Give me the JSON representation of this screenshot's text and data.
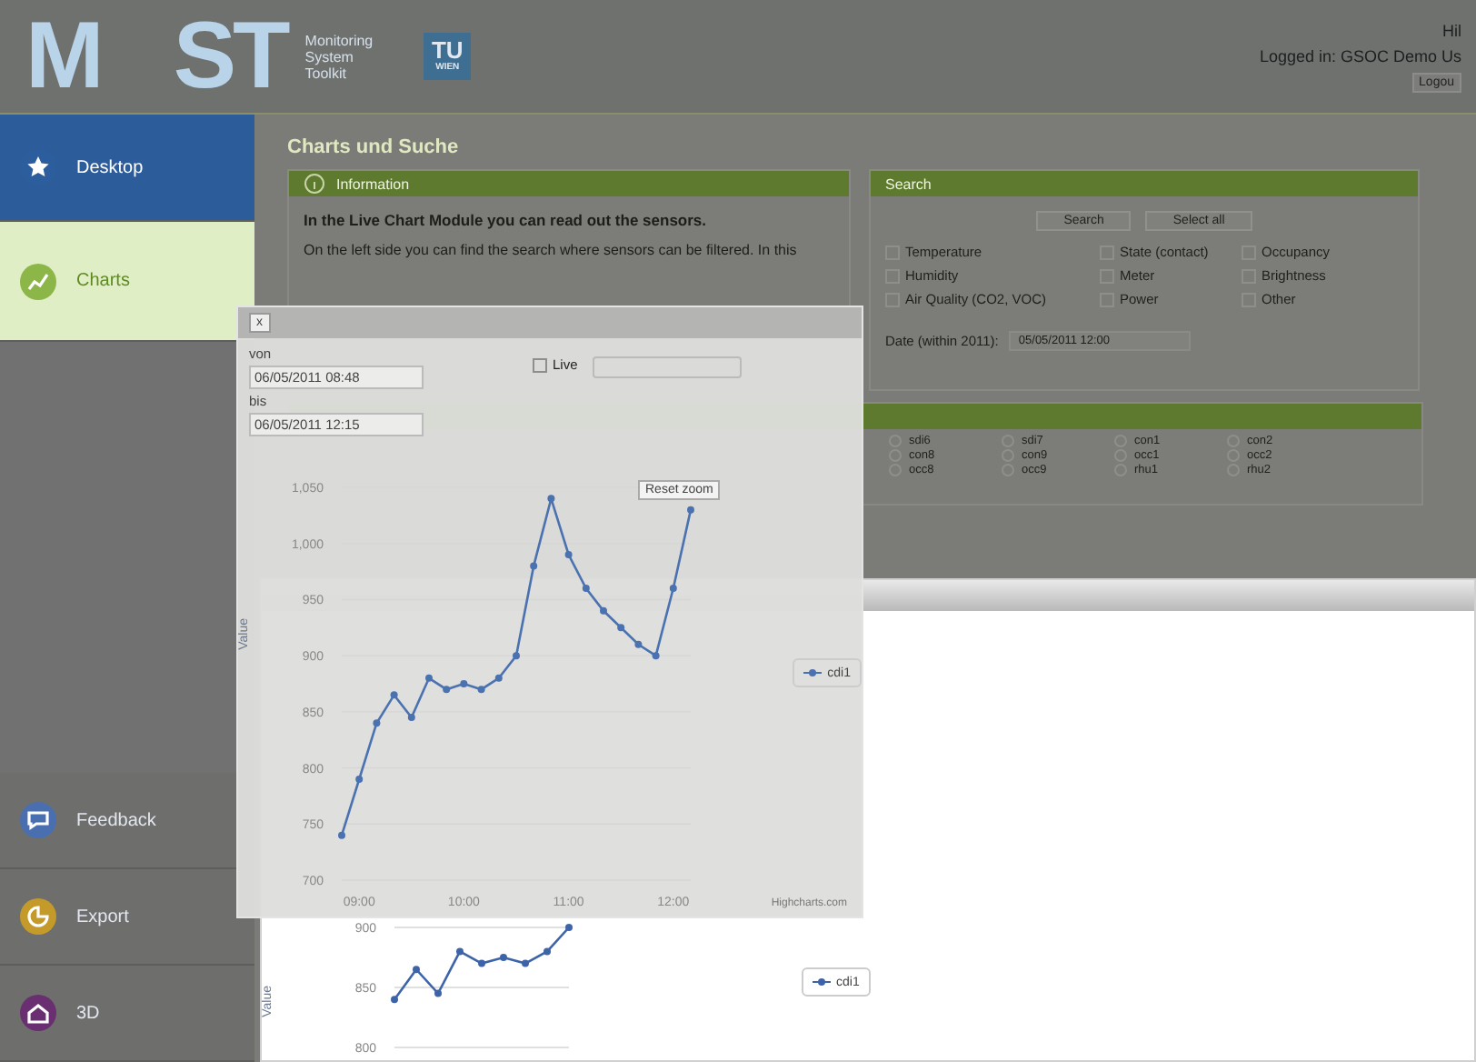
{
  "header": {
    "logo_letters": [
      "M",
      "ST"
    ],
    "logo_subtitle": [
      "Monitoring",
      "System",
      "Toolkit"
    ],
    "university_mark": "TU",
    "university_submark": "WIEN",
    "help": "Hil",
    "logged_in": "Logged in: GSOC Demo Us",
    "logout": "Logou"
  },
  "sidebar": {
    "items": [
      {
        "label": "Desktop",
        "kind": "star",
        "selected": false,
        "hovered": true,
        "color": "#2c5e9e"
      },
      {
        "label": "Charts",
        "kind": "chart",
        "selected": true,
        "hovered": false,
        "color": "#8cb648"
      },
      {
        "label": "Feedback",
        "kind": "bubble",
        "selected": false,
        "hovered": false,
        "color": "#4a6fb0"
      },
      {
        "label": "Export",
        "kind": "pie",
        "selected": false,
        "hovered": false,
        "color": "#c49a2a"
      },
      {
        "label": "3D",
        "kind": "house",
        "selected": false,
        "hovered": false,
        "color": "#6a2f70"
      }
    ]
  },
  "page_title": "Charts und Suche",
  "info": {
    "title": "Information",
    "lead": "In the Live Chart Module you can read out the sensors.",
    "text": "On the left side you can find the search where sensors can be filtered. In this"
  },
  "search": {
    "title": "Search",
    "buttons": [
      "Search",
      "Select all"
    ],
    "filters": [
      {
        "label": "Temperature",
        "checked": false
      },
      {
        "label": "State (contact)",
        "checked": false
      },
      {
        "label": "Occupancy",
        "checked": false
      },
      {
        "label": "Humidity",
        "checked": false
      },
      {
        "label": "Meter",
        "checked": false
      },
      {
        "label": "Brightness",
        "checked": false
      },
      {
        "label": "Air Quality (CO2, VOC)",
        "checked": false
      },
      {
        "label": "Power",
        "checked": false
      },
      {
        "label": "Other",
        "checked": false
      }
    ],
    "date_label": "Date (within 2011):",
    "date_value": "05/05/2011 12:00"
  },
  "sensors": {
    "items": [
      {
        "label": "sdi6",
        "selected": false
      },
      {
        "label": "sdi7",
        "selected": false
      },
      {
        "label": "con1",
        "selected": false
      },
      {
        "label": "con2",
        "selected": false
      },
      {
        "label": "con8",
        "selected": false
      },
      {
        "label": "con9",
        "selected": false
      },
      {
        "label": "occ1",
        "selected": false
      },
      {
        "label": "occ2",
        "selected": false
      },
      {
        "label": "occ8",
        "selected": false
      },
      {
        "label": "occ9",
        "selected": false
      },
      {
        "label": "rhu1",
        "selected": false
      },
      {
        "label": "rhu2",
        "selected": false
      }
    ]
  },
  "windows": [
    {
      "kind": "ghost",
      "close": "x",
      "from_label": "von",
      "from": "06/05/2011 08:48",
      "to_label": "bis",
      "to": "06/05/2011 12:15",
      "live": {
        "label": "Live",
        "checked": false
      },
      "reset": "Reset zoom",
      "credit": "Highcharts.com",
      "chart_data": {
        "type": "line",
        "ylabel": "Value",
        "grid": true,
        "categories": [
          null,
          "09:00",
          null,
          null,
          null,
          null,
          null,
          "10:00",
          null,
          null,
          null,
          null,
          null,
          "11:00",
          null,
          null,
          null,
          null,
          null,
          "12:00",
          null
        ],
        "ylim": [
          700,
          1050
        ],
        "yticks": [
          {
            "value": 700,
            "label": "700"
          },
          {
            "value": 750,
            "label": "750"
          },
          {
            "value": 800,
            "label": "800"
          },
          {
            "value": 850,
            "label": "850"
          },
          {
            "value": 900,
            "label": "900"
          },
          {
            "value": 950,
            "label": "950"
          },
          {
            "value": 1000,
            "label": "1,000"
          },
          {
            "value": 1050,
            "label": "1,050"
          }
        ],
        "series": [
          {
            "name": "cdi1",
            "color": "#4a72b0",
            "marker": "circle",
            "values": [
              740,
              790,
              840,
              865,
              845,
              880,
              870,
              875,
              870,
              880,
              900,
              980,
              1040,
              990,
              960,
              940,
              925,
              910,
              900,
              960,
              1030
            ]
          }
        ]
      }
    },
    {
      "kind": "front",
      "chart_data": {
        "type": "line",
        "ylabel": "Value",
        "grid": true,
        "ylim": [
          800,
          900
        ],
        "yticks": [
          {
            "value": 800,
            "label": "800"
          },
          {
            "value": 850,
            "label": "850"
          },
          {
            "value": 900,
            "label": "900"
          }
        ],
        "series": [
          {
            "name": "cdi1",
            "color": "#3d64a8",
            "marker": "circle",
            "values": [
              840,
              865,
              845,
              880,
              870,
              875,
              870,
              880,
              900
            ]
          }
        ]
      }
    }
  ]
}
